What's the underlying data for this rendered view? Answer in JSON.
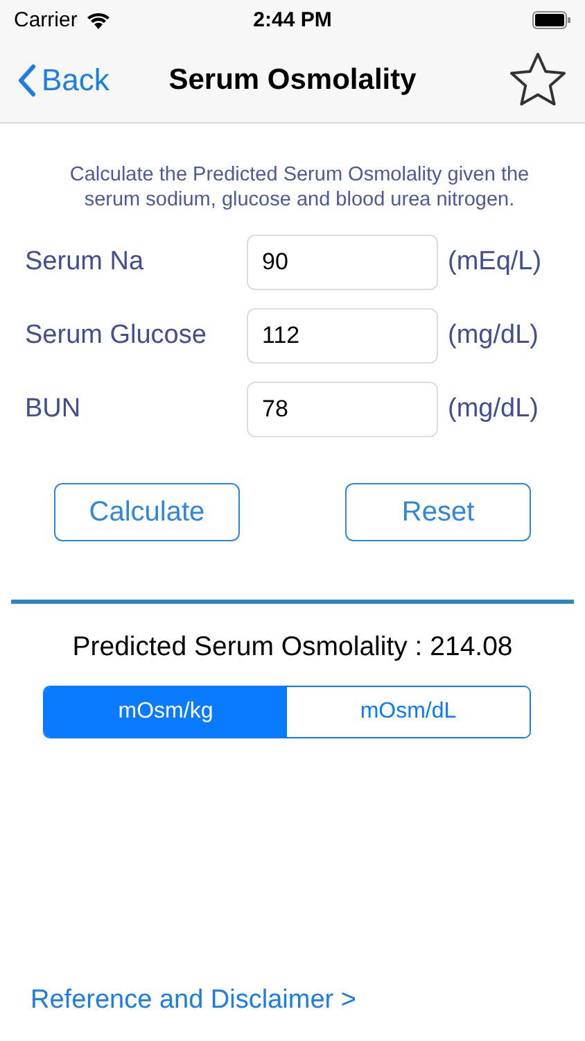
{
  "status_bar": {
    "carrier": "Carrier",
    "time": "2:44 PM"
  },
  "nav_bar": {
    "back": "Back",
    "title": "Serum Osmolality",
    "favorite": false
  },
  "description": "Calculate the Predicted Serum Osmolality given the serum sodium, glucose and blood urea nitrogen.",
  "fields": [
    {
      "label": "Serum Na",
      "value": "90",
      "unit": "(mEq/L)"
    },
    {
      "label": "Serum Glucose",
      "value": "112",
      "unit": "(mg/dL)"
    },
    {
      "label": "BUN",
      "value": "78",
      "unit": "(mg/dL)"
    }
  ],
  "buttons": [
    "Calculate",
    "Reset"
  ],
  "result": "Predicted Serum Osmolality : 214.08",
  "units": [
    {
      "label": "mOsm/kg",
      "selected": true
    },
    {
      "label": "mOsm/dL",
      "selected": false
    }
  ],
  "footer_link": "Reference and Disclaimer >"
}
